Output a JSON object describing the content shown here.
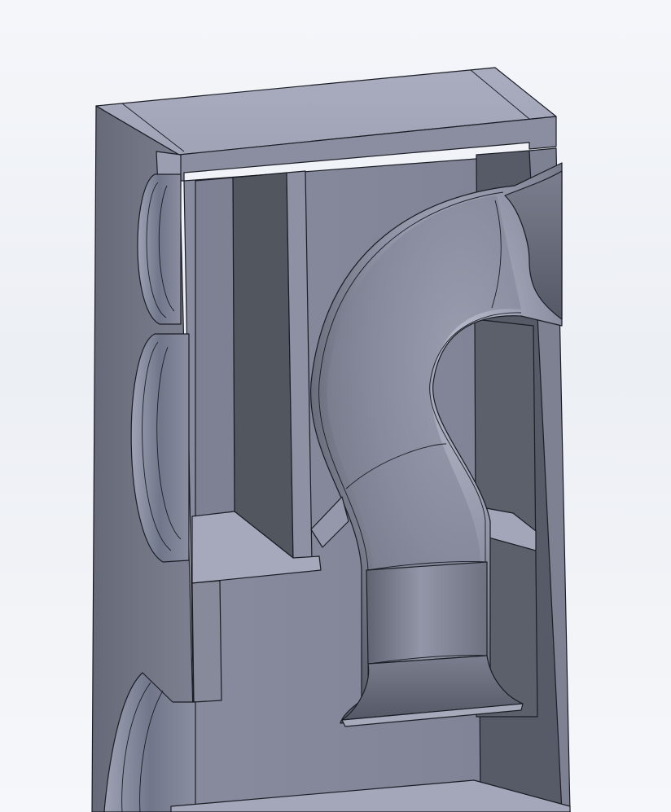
{
  "viewport": {
    "background_top": "#f4f6fa",
    "background_bottom": "#f6f7fa"
  },
  "model": {
    "kind": "3d-cad-section-view",
    "shade_light": "#b4b8c9",
    "shade_mid": "#8d91a3",
    "shade_dark": "#575b68",
    "edge_color": "#1b1d24"
  }
}
